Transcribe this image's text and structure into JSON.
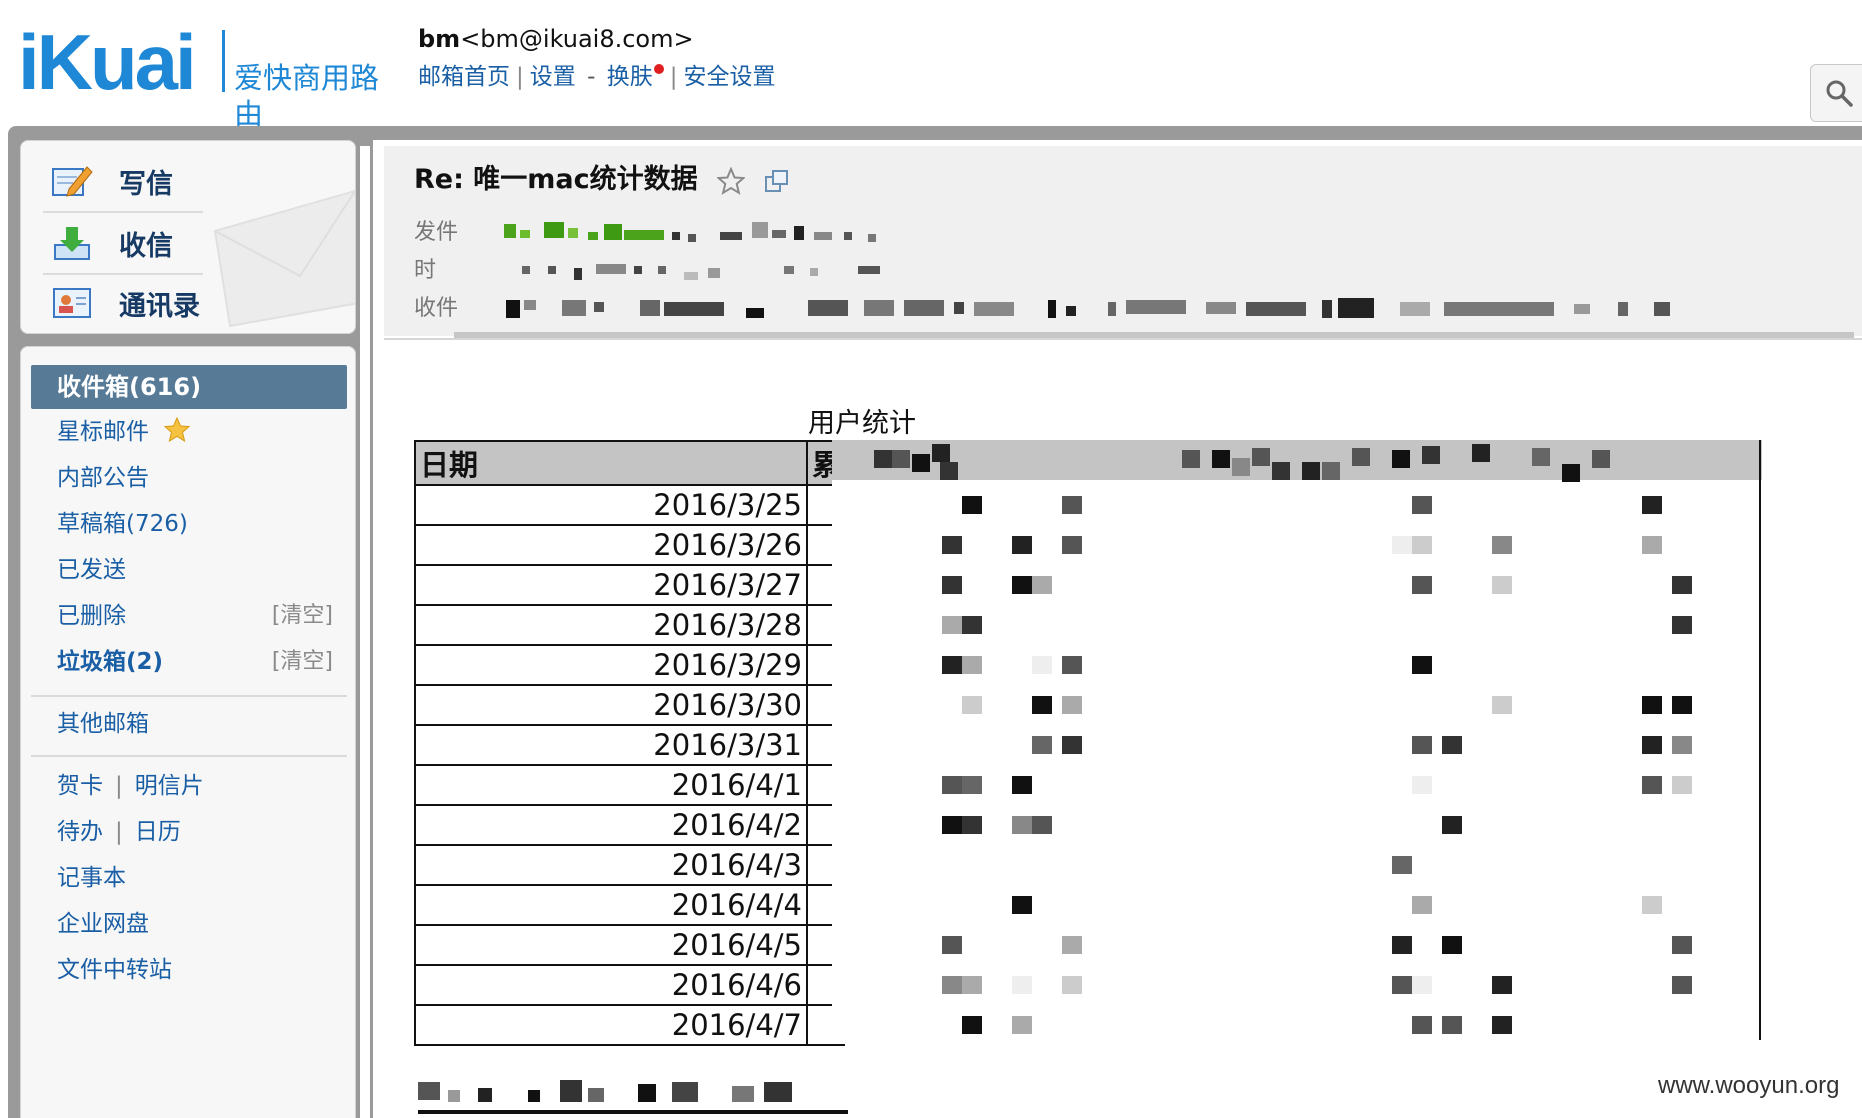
{
  "header": {
    "logo_brand": "iKuai",
    "logo_sub": "爱快商用路由",
    "account_name": "bm",
    "account_email": "<bm@ikuai8.com>",
    "nav": {
      "home": "邮箱首页",
      "settings": "设置",
      "dash": "-",
      "skin": "换肤",
      "security": "安全设置"
    }
  },
  "quick_actions": {
    "compose": "写信",
    "receive": "收信",
    "contacts": "通讯录"
  },
  "folders": {
    "inbox": "收件箱(616)",
    "starred": "星标邮件",
    "announcements": "内部公告",
    "drafts": "草稿箱(726)",
    "sent": "已发送",
    "deleted": "已删除",
    "spam": "垃圾箱(2)",
    "clear": "[清空]",
    "other": "其他邮箱",
    "card": "贺卡",
    "postcard": "明信片",
    "todo": "待办",
    "calendar": "日历",
    "notes": "记事本",
    "netdisk": "企业网盘",
    "transfer": "文件中转站"
  },
  "mail": {
    "subject": "Re: 唯一mac统计数据",
    "from_label": "发件",
    "time_label": "时",
    "to_label": "收件"
  },
  "table": {
    "title": "用户统计",
    "header_date": "日期",
    "header_col2": "累",
    "dates": [
      "2016/3/25",
      "2016/3/26",
      "2016/3/27",
      "2016/3/28",
      "2016/3/29",
      "2016/3/30",
      "2016/3/31",
      "2016/4/1",
      "2016/4/2",
      "2016/4/3",
      "2016/4/4",
      "2016/4/5",
      "2016/4/6",
      "2016/4/7"
    ]
  },
  "watermark": "www.wooyun.org"
}
